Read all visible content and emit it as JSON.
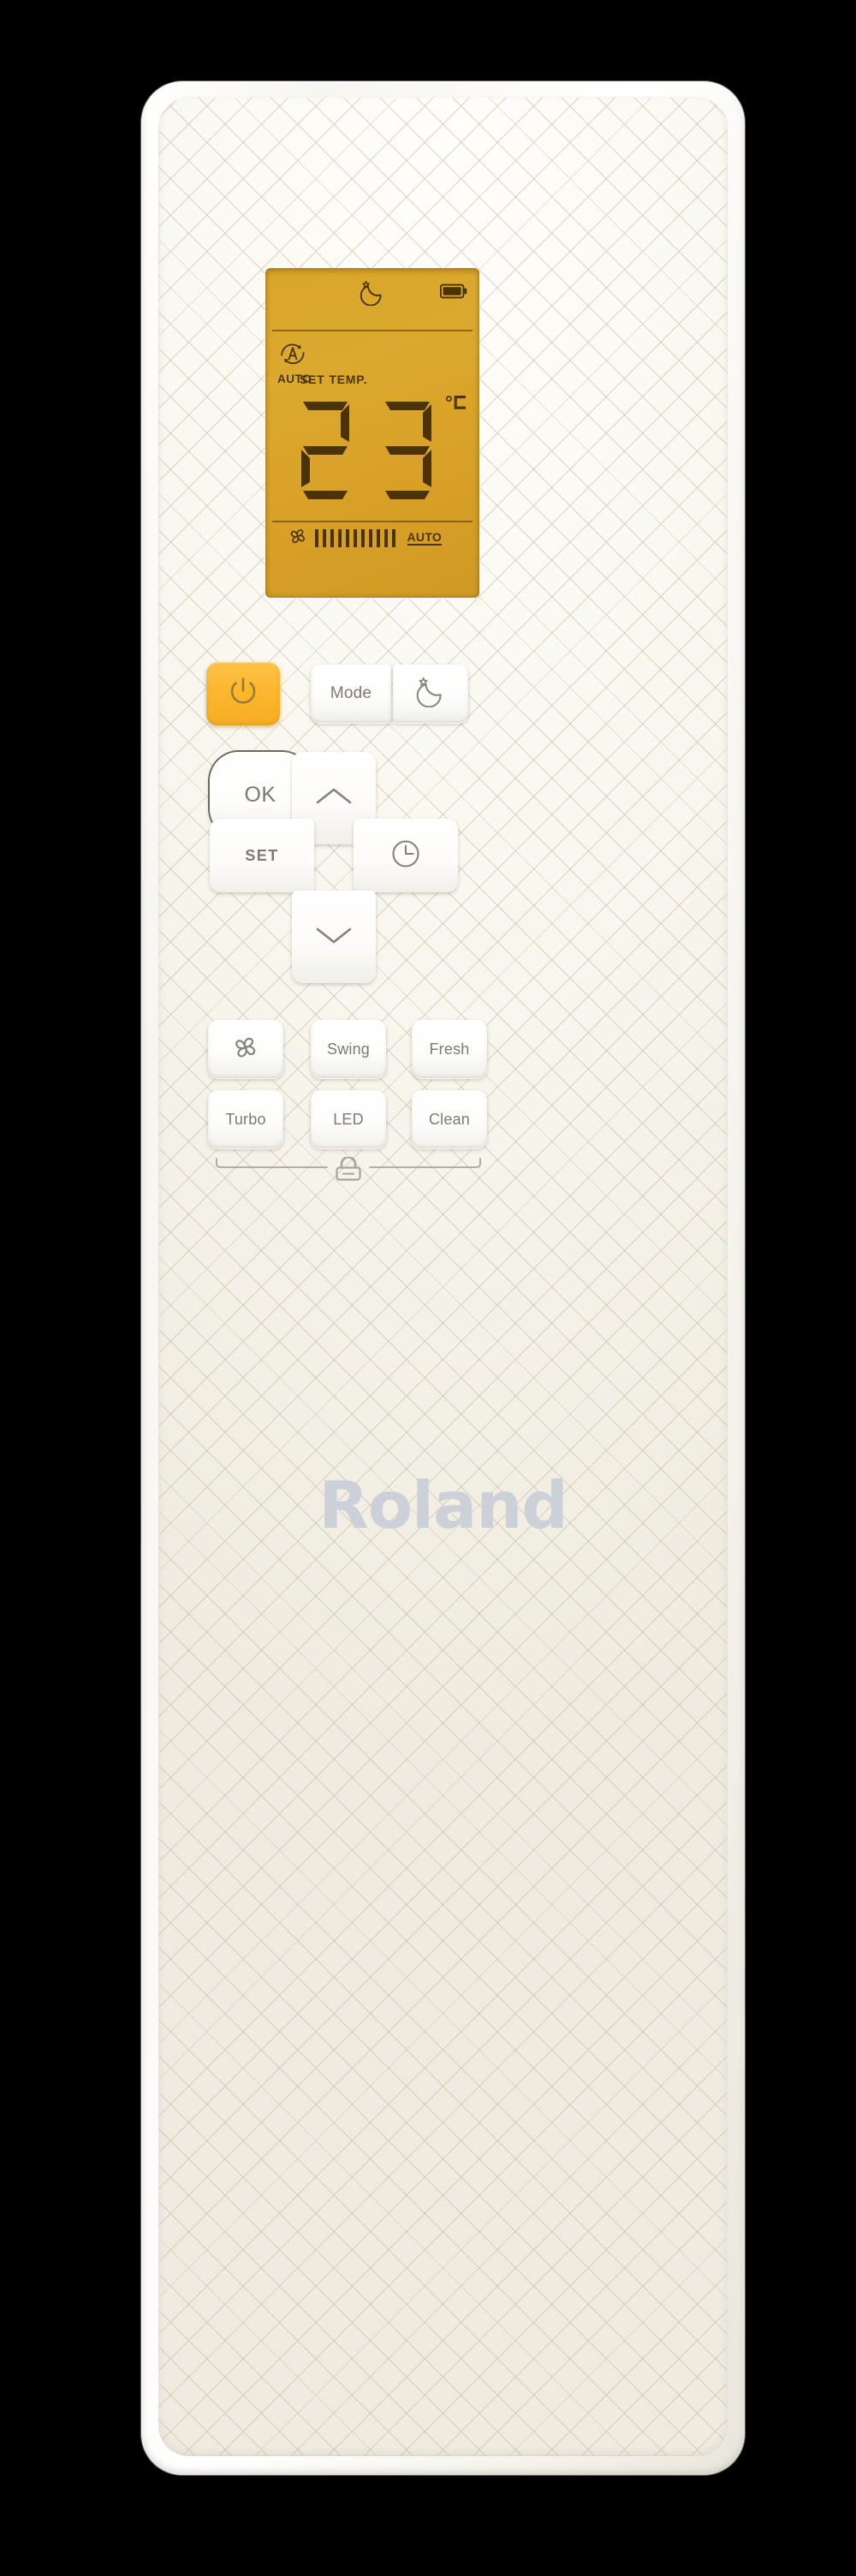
{
  "device": {
    "brand": "Roland",
    "type": "air-conditioner-remote-control",
    "body_color": "#faf8f1",
    "accent_color": "#fbb72f",
    "lcd_color": "#d9a52a",
    "lcd_text_color": "#4a3407"
  },
  "lcd": {
    "sleep_indicator": "moon-star-icon",
    "battery_indicator": "battery-full-icon",
    "mode": {
      "icon": "auto-mode-icon",
      "label": "AUTO"
    },
    "set_temp_label": "SET TEMP.",
    "temperature": "23",
    "unit": "°C",
    "fan": {
      "icon": "fan-icon",
      "bars": 11,
      "speed_label": "AUTO"
    }
  },
  "buttons": {
    "power": {
      "label": "",
      "icon": "power-icon"
    },
    "mode": {
      "label": "Mode",
      "icon": ""
    },
    "sleep": {
      "label": "",
      "icon": "moon-star-icon"
    },
    "up": {
      "label": "",
      "icon": "chevron-up-icon"
    },
    "down": {
      "label": "",
      "icon": "chevron-down-icon"
    },
    "set": {
      "label": "SET",
      "icon": ""
    },
    "ok": {
      "label": "OK",
      "icon": ""
    },
    "timer": {
      "label": "",
      "icon": "clock-icon"
    },
    "fan": {
      "label": "",
      "icon": "fan-icon"
    },
    "swing": {
      "label": "Swing",
      "icon": ""
    },
    "fresh": {
      "label": "Fresh",
      "icon": ""
    },
    "turbo": {
      "label": "Turbo",
      "icon": ""
    },
    "led": {
      "label": "LED",
      "icon": ""
    },
    "clean": {
      "label": "Clean",
      "icon": ""
    }
  },
  "lock": {
    "icon": "lock-icon",
    "label": ""
  }
}
